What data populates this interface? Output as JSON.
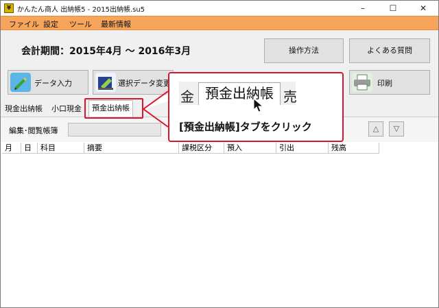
{
  "window": {
    "title": "かんたん商人 出納帳5 - 2015出納帳.su5",
    "minimize": "–",
    "maximize": "☐",
    "close": "✕"
  },
  "menu": [
    "ファイル",
    "設定",
    "ツール",
    "最新情報"
  ],
  "period": "会計期間：2015年4月 〜 2016年3月",
  "header_buttons": {
    "operation": "操作方法",
    "faq": "よくある質問"
  },
  "toolbar": {
    "data_entry": "データ入力",
    "selected_change": "選択データ変更",
    "print": "印刷"
  },
  "tabs": [
    "現金出納帳",
    "小口現金",
    "預金出納帳"
  ],
  "subpanel": {
    "edit_label": "編集･閲覧帳簿",
    "up": "△",
    "down": "▽"
  },
  "table": {
    "columns": [
      "月",
      "日",
      "科目",
      "摘要",
      "課税区分",
      "預入",
      "引出",
      "残高"
    ]
  },
  "callout": {
    "zoom_left": "金",
    "zoom_tab": "預金出納帳",
    "zoom_right": "売",
    "instruction": "[預金出納帳]タブをクリック"
  },
  "colors": {
    "menubar": "#f7a55b",
    "accent_red": "#d9142b"
  }
}
